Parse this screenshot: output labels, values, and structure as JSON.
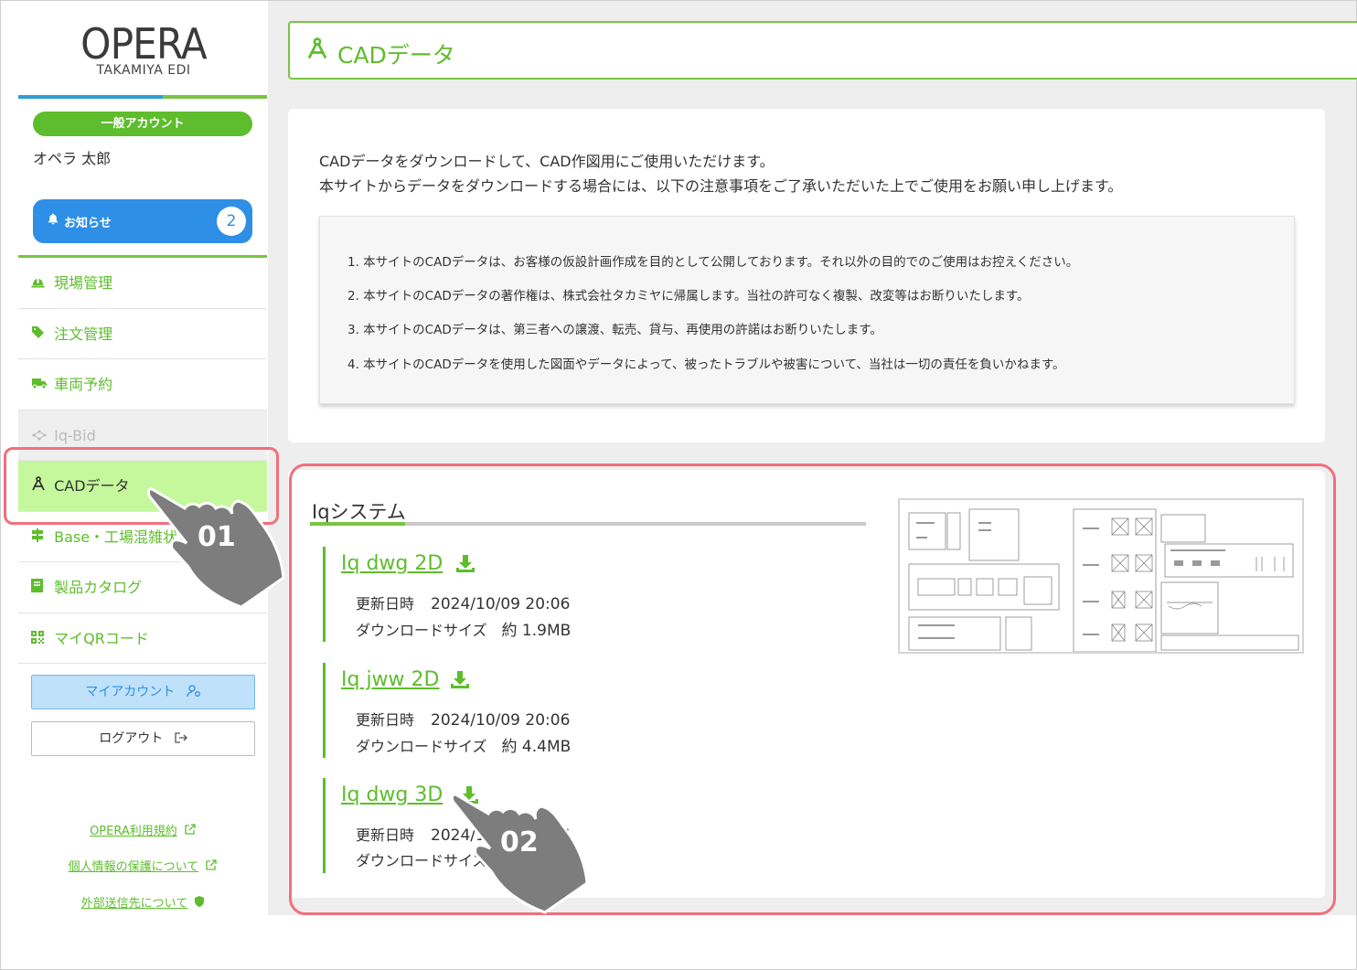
{
  "sidebar": {
    "logo_title": "OPERA",
    "logo_sub": "TAKAMIYA EDI",
    "account_type": "一般アカウント",
    "user_name": "オペラ 太郎",
    "notice_label": "お知らせ",
    "notice_count": "2",
    "nav": [
      {
        "label": "現場管理",
        "icon": "hardhat-icon"
      },
      {
        "label": "注文管理",
        "icon": "tag-icon"
      },
      {
        "label": "車両予約",
        "icon": "truck-icon"
      },
      {
        "label": "Iq-Bid",
        "icon": "network-icon"
      },
      {
        "label": "CADデータ",
        "icon": "compass-icon"
      },
      {
        "label": "Base・工場混雑状況",
        "icon": "signpost-icon"
      },
      {
        "label": "製品カタログ",
        "icon": "book-icon"
      },
      {
        "label": "マイQRコード",
        "icon": "qr-icon"
      }
    ],
    "my_account_label": "マイアカウント",
    "logout_label": "ログアウト",
    "footer_links": [
      "OPERA利用規約",
      "個人情報の保護について",
      "外部送信先について"
    ]
  },
  "header": {
    "title": "CADデータ"
  },
  "info": {
    "intro_line1": "CADデータをダウンロードして、CAD作図用にご使用いただけます。",
    "intro_line2": "本サイトからデータをダウンロードする場合には、以下の注意事項をご了承いただいた上でご使用をお願い申し上げます。",
    "notes": [
      "1. 本サイトのCADデータは、お客様の仮設計画作成を目的として公開しております。それ以外の目的でのご使用はお控えください。",
      "2. 本サイトのCADデータの著作権は、株式会社タカミヤに帰属します。当社の許可なく複製、改変等はお断りいたします。",
      "3. 本サイトのCADデータは、第三者への譲渡、転売、貸与、再使用の許諾はお断りいたします。",
      "4. 本サイトのCADデータを使用した図面やデータによって、被ったトラブルや被害について、当社は一切の責任を負いかねます。"
    ]
  },
  "system": {
    "title": "Iqシステム",
    "files": [
      {
        "name": "Iq dwg 2D",
        "updated_label": "更新日時",
        "updated": "2024/10/09 20:06",
        "size_label": "ダウンロードサイズ",
        "size": "約 1.9MB"
      },
      {
        "name": "Iq jww 2D",
        "updated_label": "更新日時",
        "updated": "2024/10/09 20:06",
        "size_label": "ダウンロードサイズ",
        "size": "約 4.4MB"
      },
      {
        "name": "Iq dwg 3D",
        "updated_label": "更新日時",
        "updated": "2024/10/09 20:06",
        "size_label": "ダウンロードサイズ",
        "size": ""
      }
    ]
  },
  "annotations": {
    "step1": "01",
    "step2": "02"
  },
  "colors": {
    "accent_green": "#5ebd2c",
    "active_bg": "#c5f79c",
    "notice_blue": "#2d8fe6",
    "highlight_red": "#f0707c"
  }
}
